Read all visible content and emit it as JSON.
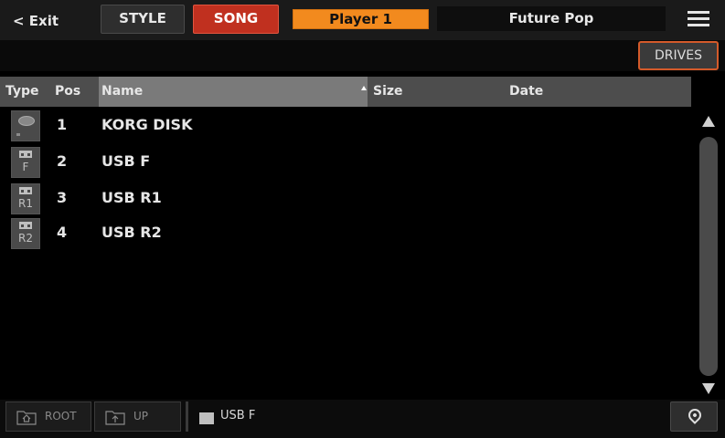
{
  "topbar": {
    "exit_label": "< Exit",
    "style_label": "STYLE",
    "song_label": "SONG",
    "player_label": "Player 1",
    "song_name": "Future Pop",
    "menu_icon": "hamburger-menu-icon"
  },
  "toolbar": {
    "drives_label": "DRIVES"
  },
  "list": {
    "headers": {
      "type": "Type",
      "pos": "Pos",
      "name": "Name",
      "size": "Size",
      "date": "Date"
    },
    "sort": {
      "column": "Name",
      "direction": "ascending"
    },
    "rows": [
      {
        "type_icon": "disk-icon",
        "type_tag": "",
        "pos": "1",
        "name": "KORG DISK"
      },
      {
        "type_icon": "usb-icon",
        "type_tag": "F",
        "pos": "2",
        "name": "USB F"
      },
      {
        "type_icon": "usb-icon",
        "type_tag": "R1",
        "pos": "3",
        "name": "USB R1"
      },
      {
        "type_icon": "usb-icon",
        "type_tag": "R2",
        "pos": "4",
        "name": "USB R2"
      }
    ]
  },
  "bottombar": {
    "root_label": "ROOT",
    "up_label": "UP",
    "current_path": "USB F",
    "locate_icon": "location-pin-icon"
  },
  "colors": {
    "song_active": "#c0301f",
    "player_highlight": "#f28a1e",
    "drives_outline": "#d45a2a"
  }
}
